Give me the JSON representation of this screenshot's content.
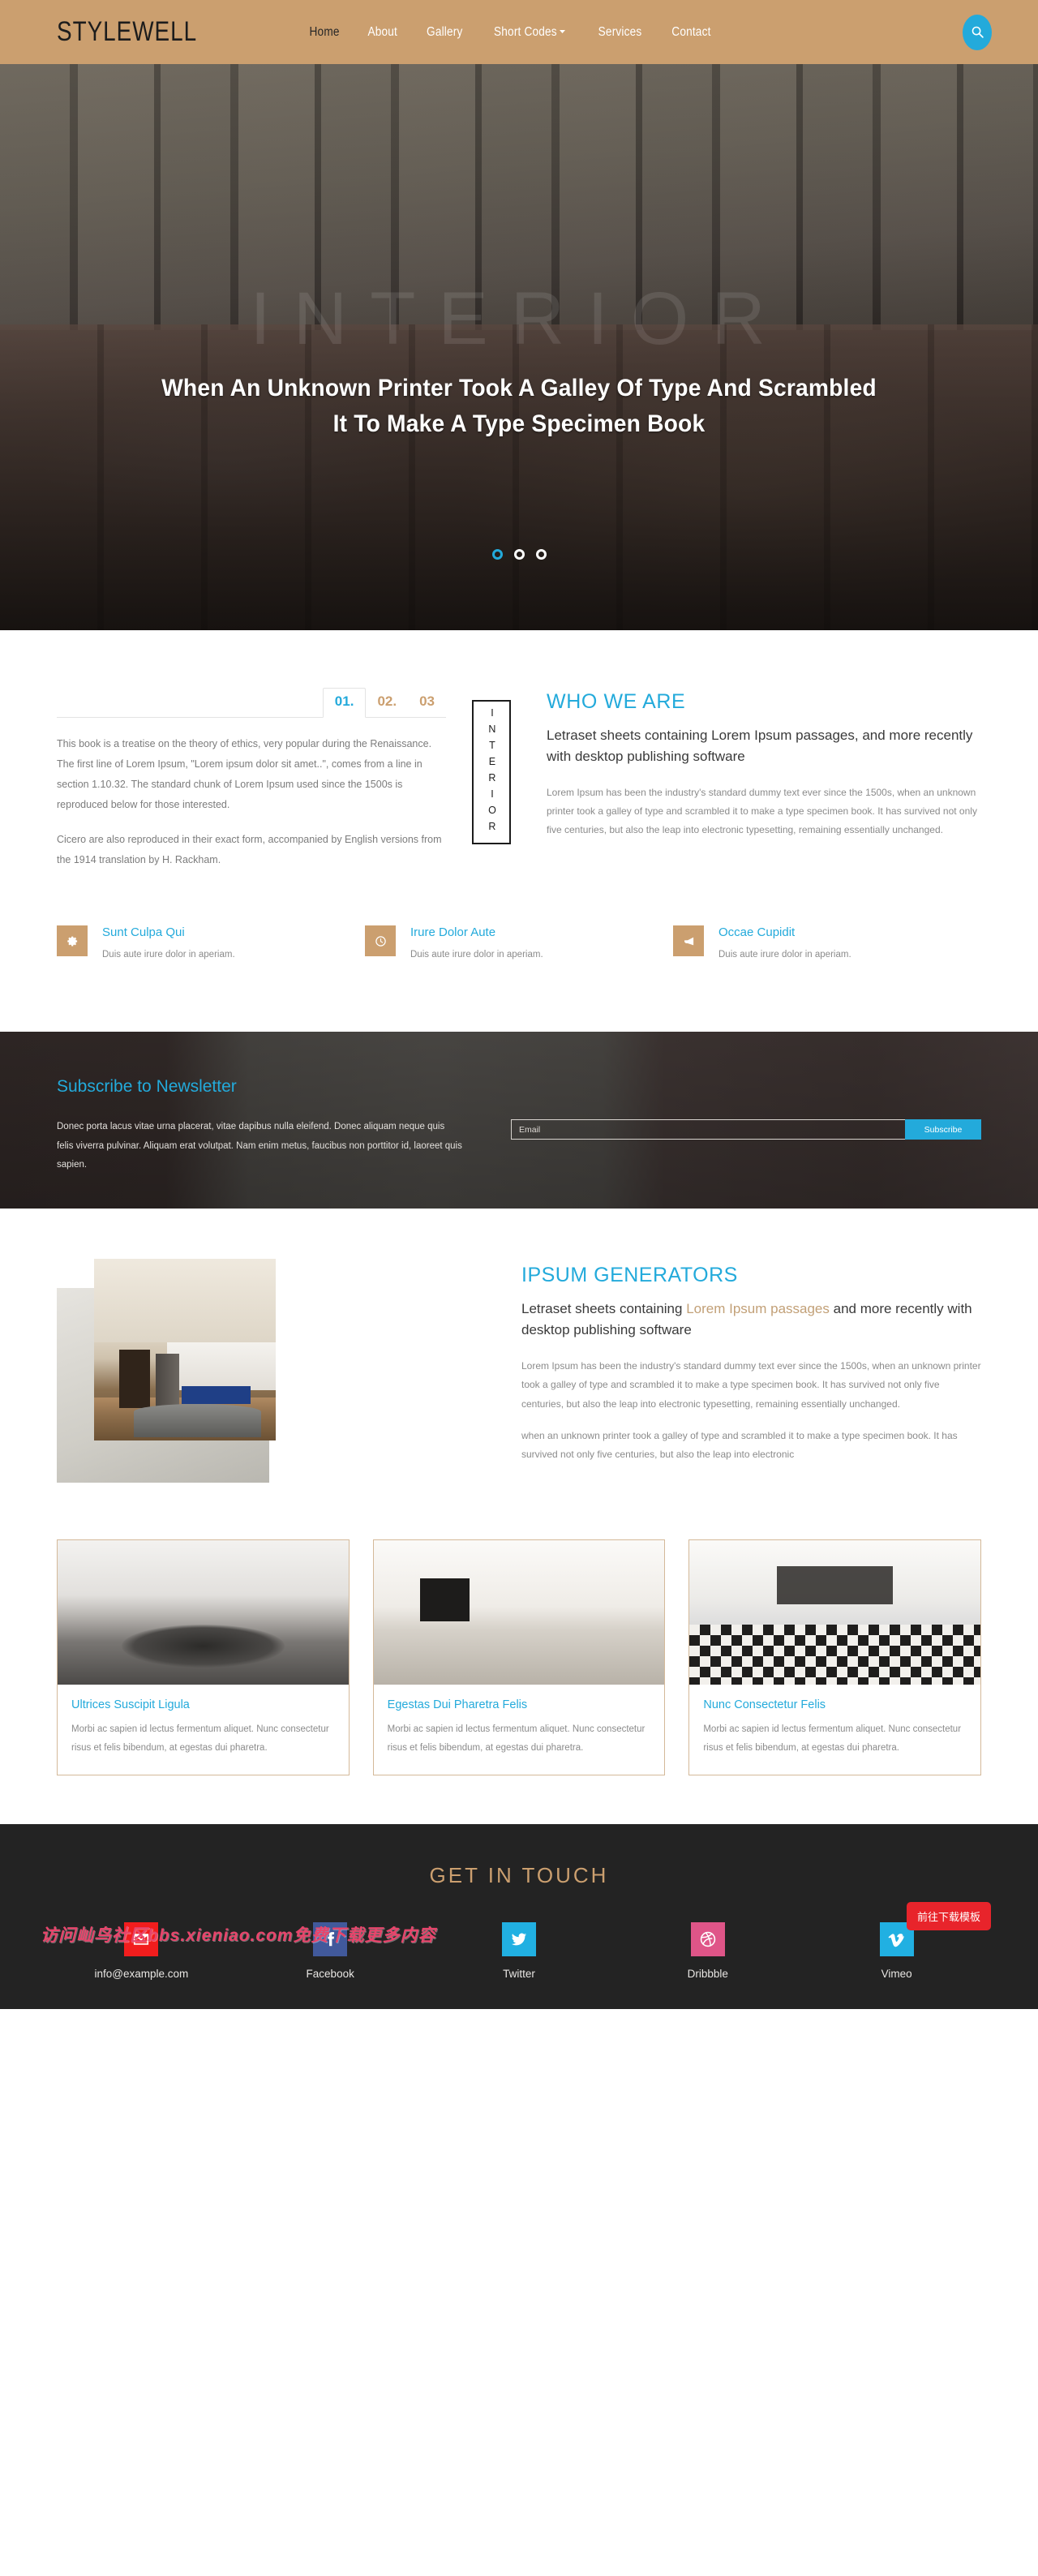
{
  "header": {
    "logo": "STYLEWELL",
    "nav": [
      {
        "label": "Home",
        "active": true,
        "caret": false
      },
      {
        "label": "About",
        "active": false,
        "caret": false
      },
      {
        "label": "Gallery",
        "active": false,
        "caret": false
      },
      {
        "label": "Short Codes",
        "active": false,
        "caret": true
      },
      {
        "label": "Services",
        "active": false,
        "caret": false
      },
      {
        "label": "Contact",
        "active": false,
        "caret": false
      }
    ],
    "search_icon": "search-icon",
    "bg_color": "#cb9f6f",
    "accent_color": "#23aadb"
  },
  "hero": {
    "watermark": "INTERIOR",
    "title_line1": "When An Unknown Printer Took A Galley Of Type And Scrambled",
    "title_line2": "It To Make A Type Specimen Book",
    "dots": [
      "1",
      "2",
      "3"
    ],
    "active_dot": 0
  },
  "about": {
    "tabs": [
      {
        "label": "01.",
        "active": true
      },
      {
        "label": "02.",
        "active": false
      },
      {
        "label": "03",
        "active": false
      }
    ],
    "paragraph1": "This book is a treatise on the theory of ethics, very popular during the Renaissance. The first line of Lorem Ipsum, \"Lorem ipsum dolor sit amet..\", comes from a line in section 1.10.32. The standard chunk of Lorem Ipsum used since the 1500s is reproduced below for those interested.",
    "paragraph2": "Cicero are also reproduced in their exact form, accompanied by English versions from the 1914 translation by H. Rackham.",
    "vertical_label": "INTERIOR",
    "title": "WHO WE ARE",
    "lead": "Letraset sheets containing Lorem Ipsum passages, and more recently with desktop publishing software",
    "body": "Lorem Ipsum has been the industry's standard dummy text ever since the 1500s, when an unknown printer took a galley of type and scrambled it to make a type specimen book. It has survived not only five centuries, but also the leap into electronic typesetting, remaining essentially unchanged."
  },
  "features": [
    {
      "icon": "gear-icon",
      "title": "Sunt Culpa Qui",
      "desc": "Duis aute irure dolor in aperiam."
    },
    {
      "icon": "clock-icon",
      "title": "Irure Dolor Aute",
      "desc": "Duis aute irure dolor in aperiam."
    },
    {
      "icon": "megaphone-icon",
      "title": "Occae Cupidit",
      "desc": "Duis aute irure dolor in aperiam."
    }
  ],
  "newsletter": {
    "title": "Subscribe to Newsletter",
    "desc": "Donec porta lacus vitae urna placerat, vitae dapibus nulla eleifend. Donec aliquam neque quis felis viverra pulvinar. Aliquam erat volutpat. Nam enim metus, faucibus non porttitor id, laoreet quis sapien.",
    "input_placeholder": "Email",
    "input_value": "",
    "button": "Subscribe",
    "button_color": "#23aadb"
  },
  "ipsum": {
    "title": "IPSUM GENERATORS",
    "lead_part1": "Letraset sheets containing ",
    "lead_accent": "Lorem Ipsum passages",
    "lead_part2": " and more recently with desktop publishing software",
    "body1": "Lorem Ipsum has been the industry's standard dummy text ever since the 1500s, when an unknown printer took a galley of type and scrambled it to make a type specimen book. It has survived not only five centuries, but also the leap into electronic typesetting, remaining essentially unchanged.",
    "body2": "when an unknown printer took a galley of type and scrambled it to make a type specimen book. It has survived not only five centuries, but also the leap into electronic"
  },
  "cards": [
    {
      "title": "Ultrices Suscipit Ligula",
      "desc": "Morbi ac sapien id lectus fermentum aliquet. Nunc consectetur risus et felis bibendum, at egestas dui pharetra."
    },
    {
      "title": "Egestas Dui Pharetra Felis",
      "desc": "Morbi ac sapien id lectus fermentum aliquet. Nunc consectetur risus et felis bibendum, at egestas dui pharetra."
    },
    {
      "title": "Nunc Consectetur Felis",
      "desc": "Morbi ac sapien id lectus fermentum aliquet. Nunc consectetur risus et felis bibendum, at egestas dui pharetra."
    }
  ],
  "footer": {
    "title": "GET IN TOUCH",
    "socials": [
      {
        "icon": "envelope-icon",
        "label": "info@example.com",
        "color": "#f21d1d"
      },
      {
        "icon": "facebook-icon",
        "label": "Facebook",
        "color": "#41599b"
      },
      {
        "icon": "twitter-icon",
        "label": "Twitter",
        "color": "#21b0e2"
      },
      {
        "icon": "dribbble-icon",
        "label": "Dribbble",
        "color": "#df5588"
      },
      {
        "icon": "vimeo-icon",
        "label": "Vimeo",
        "color": "#21b0e2"
      }
    ],
    "watermark_text": "访问屾鸟社区bbs.xieniao.com免费下载更多内容",
    "download_button": "前往下载模板"
  }
}
